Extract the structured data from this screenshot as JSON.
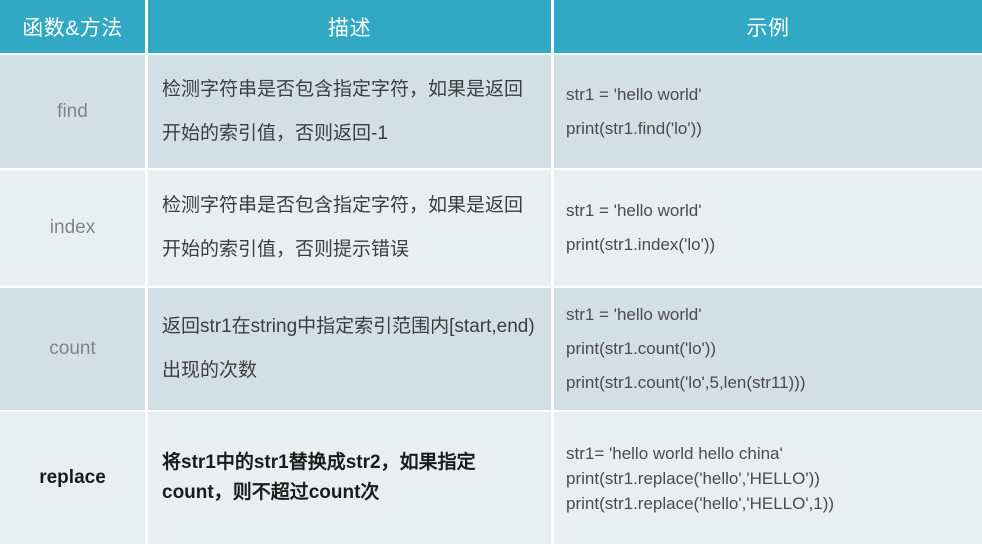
{
  "table": {
    "headers": [
      {
        "label": "函数&方法"
      },
      {
        "label": "描述"
      },
      {
        "label": "示例"
      }
    ],
    "rows": [
      {
        "func": "find",
        "desc": "检测字符串是否包含指定字符，如果是返回开始的索引值，否则返回-1",
        "example_lines": [
          "str1 = 'hello world'",
          "print(str1.find('lo'))"
        ]
      },
      {
        "func": "index",
        "desc": "检测字符串是否包含指定字符，如果是返回开始的索引值，否则提示错误",
        "example_lines": [
          "str1 = 'hello world'",
          "print(str1.index('lo'))"
        ]
      },
      {
        "func": "count",
        "desc": "返回str1在string中指定索引范围内[start,end)出现的次数",
        "example_lines": [
          "str1 = 'hello world'",
          "print(str1.count('lo'))",
          "print(str1.count('lo',5,len(str11)))"
        ]
      },
      {
        "func": "replace",
        "desc": "将str1中的str1替换成str2，如果指定count，则不超过count次",
        "example_lines": [
          "str1= 'hello world hello china'",
          "print(str1.replace('hello','HELLO'))",
          "print(str1.replace('hello','HELLO',1))"
        ]
      }
    ]
  },
  "colors": {
    "header_bg": "#31A8C4",
    "header_text": "#FFFFFF",
    "row_dark_bg": "#D2E0E6",
    "row_light_bg": "#E9EFF1",
    "body_text": "#3D3D3D",
    "func_text": "#808487",
    "grid_line": "#FFFFFF"
  }
}
